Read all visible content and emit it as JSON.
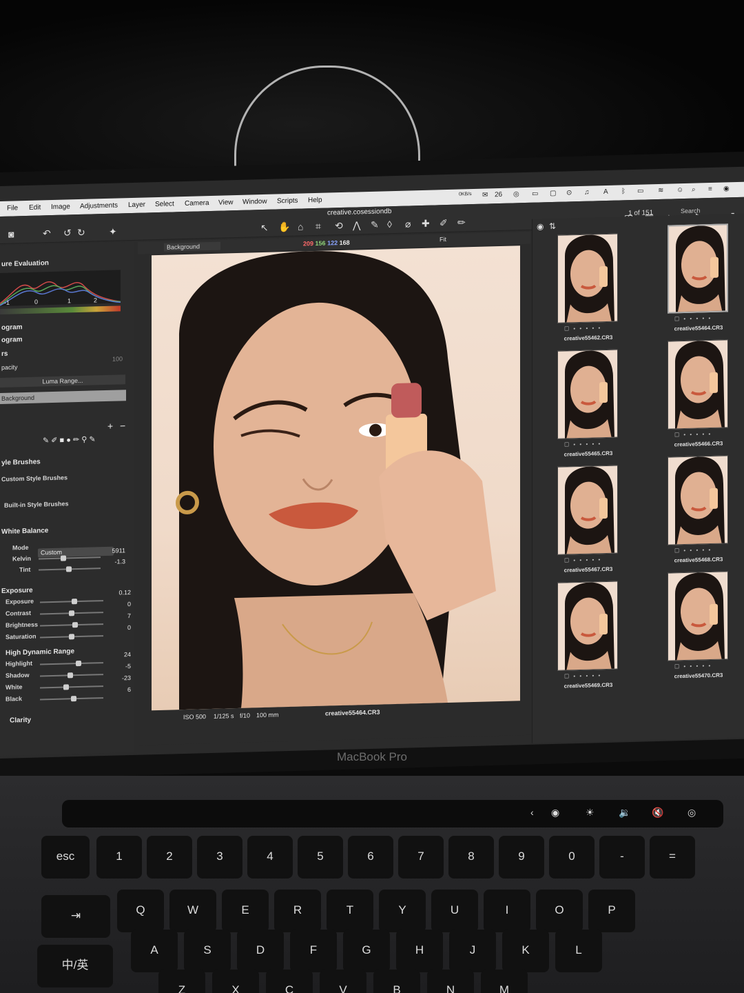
{
  "menu": {
    "items": [
      "File",
      "Edit",
      "Image",
      "Adjustments",
      "Layer",
      "Select",
      "Camera",
      "View",
      "Window",
      "Scripts",
      "Help"
    ],
    "status_count": "26",
    "net": "0KB/s"
  },
  "toolbar": {
    "doc_title": "creative.cosessiondb",
    "count": "1 of 151",
    "search": "Search",
    "fit": "Fit"
  },
  "left": {
    "exposure_eval": "ure Evaluation",
    "scale_labels": [
      "-1",
      "0",
      "1",
      "2"
    ],
    "histogram": "ogram",
    "histogram2": "ogram",
    "layers": "rs",
    "opacity_label": "pacity",
    "opacity_value": "100",
    "luma": "Luma Range...",
    "background_layer": "Background",
    "style_brushes": "yle Brushes",
    "custom_brushes": "Custom Style Brushes",
    "builtin_brushes": "Built-in Style Brushes",
    "white_balance": "White Balance",
    "mode_label": "Mode",
    "mode_value": "Custom",
    "kelvin_label": "Kelvin",
    "kelvin_value": "5911",
    "tint_label": "Tint",
    "tint_value": "-1.3",
    "exposure_section": "Exposure",
    "exposure_rows": [
      {
        "label": "Exposure",
        "value": "0.12",
        "level": 0.55
      },
      {
        "label": "Contrast",
        "value": "0",
        "level": 0.5
      },
      {
        "label": "Brightness",
        "value": "7",
        "level": 0.56
      },
      {
        "label": "Saturation",
        "value": "0",
        "level": 0.5
      }
    ],
    "hdr_section": "High Dynamic Range",
    "hdr_rows": [
      {
        "label": "Highlight",
        "value": "24",
        "level": 0.62
      },
      {
        "label": "Shadow",
        "value": "-5",
        "level": 0.48
      },
      {
        "label": "White",
        "value": "-23",
        "level": 0.4
      },
      {
        "label": "Black",
        "value": "6",
        "level": 0.53
      }
    ],
    "clarity": "Clarity"
  },
  "viewer": {
    "layer_select": "Background",
    "rgb": {
      "r": "209",
      "g": "156",
      "b": "122",
      "l": "168"
    },
    "exif": {
      "iso": "ISO 500",
      "shutter": "1/125 s",
      "aperture": "f/10",
      "focal": "100 mm",
      "file": "creative55464.CR3"
    }
  },
  "browser": {
    "thumbs": [
      {
        "name": "creative55462.CR3"
      },
      {
        "name": "creative55464.CR3",
        "selected": true
      },
      {
        "name": "creative55465.CR3"
      },
      {
        "name": "creative55466.CR3"
      },
      {
        "name": "creative55467.CR3"
      },
      {
        "name": "creative55468.CR3"
      },
      {
        "name": "creative55469.CR3"
      },
      {
        "name": "creative55470.CR3"
      }
    ]
  },
  "laptop": {
    "brand": "MacBook Pro",
    "keys_row1": [
      "esc",
      "!\n1",
      "@\n2",
      "#\n3",
      "¥ $\n4",
      "%\n5",
      "… ^\n6",
      "&\n7",
      "*\n8",
      "(\n9",
      ")\n0",
      "—\n-",
      "+\n="
    ],
    "keys_row2": [
      "Q",
      "W",
      "E",
      "R",
      "T",
      "Y",
      "U",
      "I",
      "O",
      "P"
    ],
    "keys_row3": [
      "A",
      "S",
      "D",
      "F",
      "G",
      "H",
      "J",
      "K",
      "L"
    ],
    "keys_row4": [
      "Z",
      "X",
      "C",
      "V",
      "B",
      "N",
      "M"
    ],
    "lang_key": "中/英",
    "tab_key": "⇥"
  }
}
